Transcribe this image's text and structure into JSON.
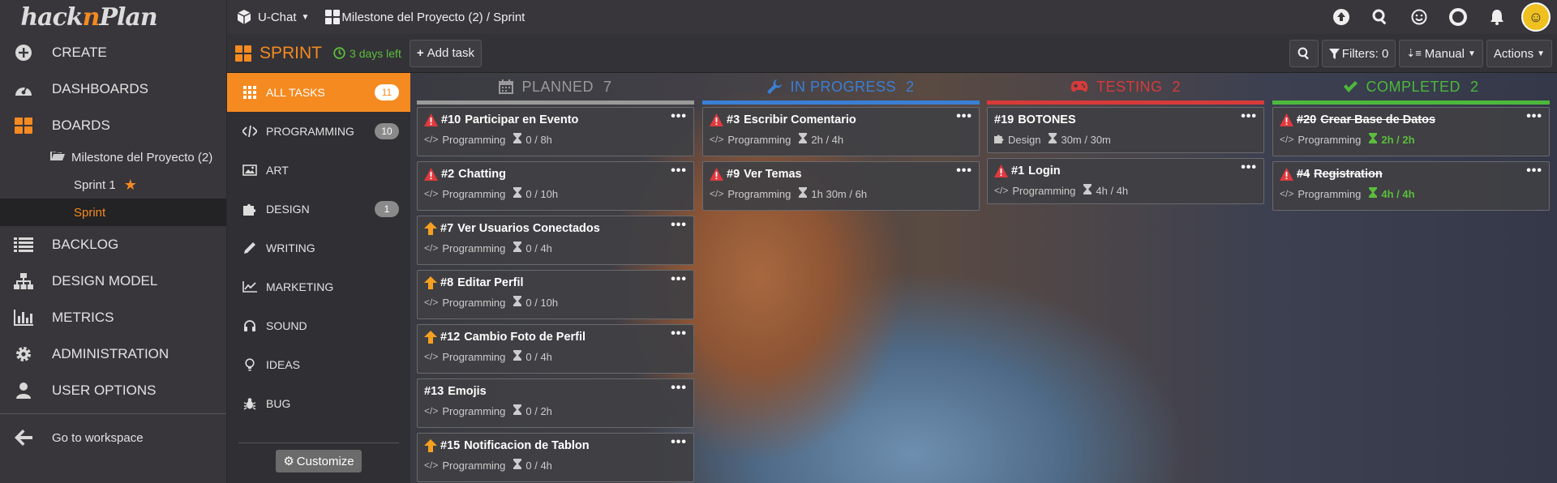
{
  "app": {
    "logo_a": "hack",
    "logo_n": "n",
    "logo_b": "Plan"
  },
  "nav": {
    "create": "CREATE",
    "dashboards": "DASHBOARDS",
    "boards": "BOARDS",
    "milestone": "Milestone del Proyecto (2)",
    "sprint1": "Sprint 1",
    "sprint": "Sprint",
    "backlog": "BACKLOG",
    "design_model": "DESIGN MODEL",
    "metrics": "METRICS",
    "administration": "ADMINISTRATION",
    "user_options": "USER OPTIONS",
    "goto_workspace": "Go to workspace"
  },
  "topbar": {
    "project": "U-Chat",
    "breadcrumb": "Milestone del Proyecto (2) / Sprint"
  },
  "sprint": {
    "title": "SPRINT",
    "days_left": "3 days left",
    "add_task": "Add task",
    "filters": "Filters: 0",
    "sort": "Manual",
    "actions": "Actions"
  },
  "categories": [
    {
      "label": "ALL TASKS",
      "count": "11"
    },
    {
      "label": "PROGRAMMING",
      "count": "10"
    },
    {
      "label": "ART",
      "count": ""
    },
    {
      "label": "DESIGN",
      "count": "1"
    },
    {
      "label": "WRITING",
      "count": ""
    },
    {
      "label": "MARKETING",
      "count": ""
    },
    {
      "label": "SOUND",
      "count": ""
    },
    {
      "label": "IDEAS",
      "count": ""
    },
    {
      "label": "BUG",
      "count": ""
    }
  ],
  "customize": "Customize",
  "columns": [
    {
      "name": "PLANNED",
      "count": "7",
      "color": "#9a9a9a"
    },
    {
      "name": "IN PROGRESS",
      "count": "2",
      "color": "#3a7fd5"
    },
    {
      "name": "TESTING",
      "count": "2",
      "color": "#d83a3a"
    },
    {
      "name": "COMPLETED",
      "count": "2",
      "color": "#4cb83c"
    }
  ],
  "cards": {
    "c0": [
      {
        "num": "#10",
        "title": "Participar en Evento",
        "cat": "Programming",
        "est": "0 / 8h",
        "pri": "alert"
      },
      {
        "num": "#2",
        "title": "Chatting",
        "cat": "Programming",
        "est": "0 / 10h",
        "pri": "alert"
      },
      {
        "num": "#7",
        "title": "Ver Usuarios Conectados",
        "cat": "Programming",
        "est": "0 / 4h",
        "pri": "up"
      },
      {
        "num": "#8",
        "title": "Editar Perfil",
        "cat": "Programming",
        "est": "0 / 10h",
        "pri": "up"
      },
      {
        "num": "#12",
        "title": "Cambio Foto de Perfil",
        "cat": "Programming",
        "est": "0 / 4h",
        "pri": "up"
      },
      {
        "num": "#13",
        "title": "Emojis",
        "cat": "Programming",
        "est": "0 / 2h",
        "pri": "none"
      },
      {
        "num": "#15",
        "title": "Notificacion de Tablon",
        "cat": "Programming",
        "est": "0 / 4h",
        "pri": "up"
      }
    ],
    "c1": [
      {
        "num": "#3",
        "title": "Escribir Comentario",
        "cat": "Programming",
        "est": "2h / 4h",
        "pri": "alert"
      },
      {
        "num": "#9",
        "title": "Ver Temas",
        "cat": "Programming",
        "est": "1h 30m / 6h",
        "pri": "alert"
      }
    ],
    "c2": [
      {
        "num": "#19",
        "title": "BOTONES",
        "cat": "Design",
        "est": "30m / 30m",
        "pri": "none"
      },
      {
        "num": "#1",
        "title": "Login",
        "cat": "Programming",
        "est": "4h / 4h",
        "pri": "alert"
      }
    ],
    "c3": [
      {
        "num": "#20",
        "title": "Crear Base de Datos",
        "cat": "Programming",
        "est": "2h / 2h",
        "pri": "alert"
      },
      {
        "num": "#4",
        "title": "Registration",
        "cat": "Programming",
        "est": "4h / 4h",
        "pri": "alert"
      }
    ]
  },
  "card_menu": "•••",
  "colors": {
    "accent": "#f58a20",
    "done_green": "#5cbd3c"
  }
}
